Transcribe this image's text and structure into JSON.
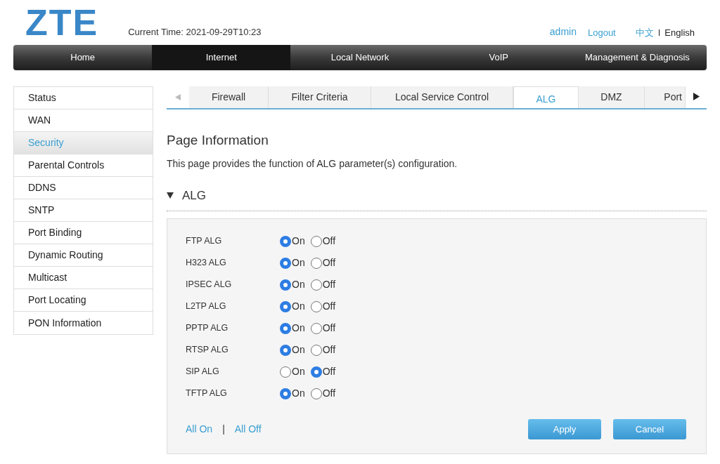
{
  "header": {
    "logo": "ZTE",
    "current_time": "Current Time: 2021-09-29T10:23",
    "user": "admin",
    "logout": "Logout",
    "languages": [
      {
        "label": "中文",
        "selected": false
      },
      {
        "label": "English",
        "selected": true
      }
    ],
    "language_separator": "I"
  },
  "nav": [
    {
      "label": "Home",
      "selected": false
    },
    {
      "label": "Internet",
      "selected": true
    },
    {
      "label": "Local Network",
      "selected": false
    },
    {
      "label": "VoIP",
      "selected": false
    },
    {
      "label": "Management & Diagnosis",
      "selected": false
    }
  ],
  "sidebar": {
    "items": [
      {
        "label": "Status",
        "selected": false
      },
      {
        "label": "WAN",
        "selected": false
      },
      {
        "label": "Security",
        "selected": true
      },
      {
        "label": "Parental Controls",
        "selected": false
      },
      {
        "label": "DDNS",
        "selected": false
      },
      {
        "label": "SNTP",
        "selected": false
      },
      {
        "label": "Port Binding",
        "selected": false
      },
      {
        "label": "Dynamic Routing",
        "selected": false
      },
      {
        "label": "Multicast",
        "selected": false
      },
      {
        "label": "Port Locating",
        "selected": false
      },
      {
        "label": "PON Information",
        "selected": false
      }
    ]
  },
  "tabs": [
    {
      "label": "Firewall",
      "selected": false
    },
    {
      "label": "Filter Criteria",
      "selected": false
    },
    {
      "label": "Local Service Control",
      "selected": false
    },
    {
      "label": "ALG",
      "selected": true
    },
    {
      "label": "DMZ",
      "selected": false
    },
    {
      "label": "Port",
      "selected": false
    }
  ],
  "page_info": {
    "title": "Page Information",
    "description": "This page provides the function of ALG parameter(s) configuration."
  },
  "section": {
    "title": "ALG",
    "expanded": true,
    "rows": [
      {
        "label": "FTP ALG",
        "options": [
          {
            "label": "On",
            "selected": true
          },
          {
            "label": "Off",
            "selected": false
          }
        ]
      },
      {
        "label": "H323 ALG",
        "options": [
          {
            "label": "On",
            "selected": true
          },
          {
            "label": "Off",
            "selected": false
          }
        ]
      },
      {
        "label": "IPSEC ALG",
        "options": [
          {
            "label": "On",
            "selected": true
          },
          {
            "label": "Off",
            "selected": false
          }
        ]
      },
      {
        "label": "L2TP ALG",
        "options": [
          {
            "label": "On",
            "selected": true
          },
          {
            "label": "Off",
            "selected": false
          }
        ]
      },
      {
        "label": "PPTP ALG",
        "options": [
          {
            "label": "On",
            "selected": true
          },
          {
            "label": "Off",
            "selected": false
          }
        ]
      },
      {
        "label": "RTSP ALG",
        "options": [
          {
            "label": "On",
            "selected": true
          },
          {
            "label": "Off",
            "selected": false
          }
        ]
      },
      {
        "label": "SIP ALG",
        "options": [
          {
            "label": "On",
            "selected": false
          },
          {
            "label": "Off",
            "selected": true
          }
        ]
      },
      {
        "label": "TFTP ALG",
        "options": [
          {
            "label": "On",
            "selected": true
          },
          {
            "label": "Off",
            "selected": false
          }
        ]
      }
    ],
    "all_on": "All On",
    "separator": "|",
    "all_off": "All Off",
    "buttons": [
      "Apply",
      "Cancel"
    ]
  }
}
